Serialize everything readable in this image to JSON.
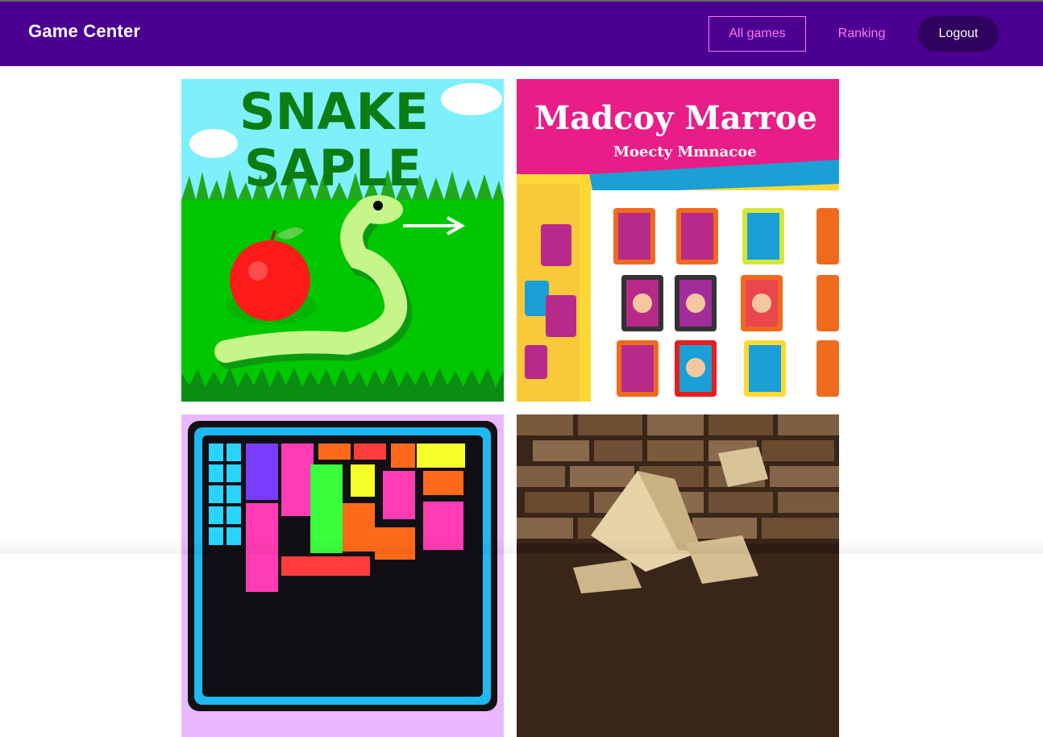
{
  "app": {
    "title": "Game Center"
  },
  "nav": {
    "all_games": "All games",
    "ranking": "Ranking",
    "logout": "Logout"
  },
  "games": [
    {
      "name": "snake",
      "thumb_text": [
        "SNAKE",
        "SAPLE"
      ]
    },
    {
      "name": "memory",
      "thumb_text": [
        "Madcoy Marroe",
        "Moecty Mmnacoe"
      ]
    },
    {
      "name": "tetris",
      "thumb_text": []
    },
    {
      "name": "bricks",
      "thumb_text": []
    }
  ],
  "colors": {
    "header_bg": "#4b0092",
    "nav_accent": "#ff7ae8",
    "logout_bg": "#30005e"
  }
}
